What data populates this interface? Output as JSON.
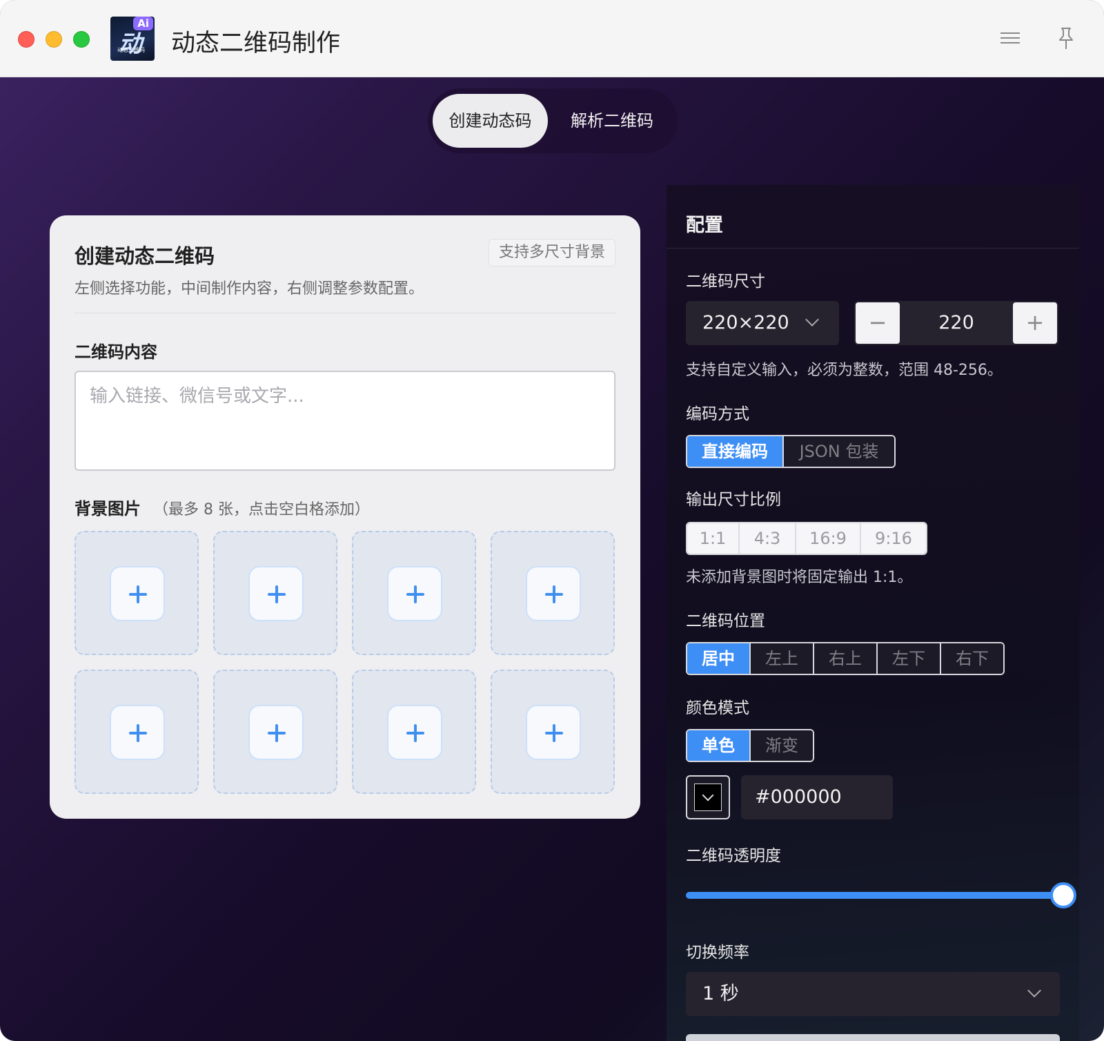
{
  "window": {
    "title": "动态二维码制作",
    "app_icon": {
      "badge": "Ai",
      "glyph": "动",
      "caption": "动态二维码"
    }
  },
  "tabs": [
    {
      "label": "创建动态码",
      "active": true
    },
    {
      "label": "解析二维码",
      "active": false
    }
  ],
  "create_card": {
    "title": "创建动态二维码",
    "badge": "支持多尺寸背景",
    "description": "左侧选择功能，中间制作内容，右侧调整参数配置。",
    "content_label": "二维码内容",
    "content_placeholder": "输入链接、微信号或文字...",
    "content_value": "",
    "bg_label": "背景图片",
    "bg_hint": "（最多 8 张，点击空白格添加）",
    "bg_slot_count": 8
  },
  "config": {
    "title": "配置",
    "size": {
      "label": "二维码尺寸",
      "preset": "220×220",
      "value": "220",
      "minus": "−",
      "plus": "+",
      "note": "支持自定义输入，必须为整数，范围 48-256。"
    },
    "encoding": {
      "label": "编码方式",
      "options": [
        "直接编码",
        "JSON 包装"
      ],
      "selected": "直接编码"
    },
    "aspect": {
      "label": "输出尺寸比例",
      "options": [
        "1:1",
        "4:3",
        "16:9",
        "9:16"
      ],
      "note": "未添加背景图时将固定输出 1:1。"
    },
    "position": {
      "label": "二维码位置",
      "options": [
        "居中",
        "左上",
        "右上",
        "左下",
        "右下"
      ],
      "selected": "居中"
    },
    "color_mode": {
      "label": "颜色模式",
      "options": [
        "单色",
        "渐变"
      ],
      "selected": "单色",
      "color_hex": "#000000"
    },
    "opacity": {
      "label": "二维码透明度",
      "value": 1.0,
      "accent": "#3d8ef5"
    },
    "frequency": {
      "label": "切换频率",
      "value": "1 秒"
    }
  },
  "colors": {
    "accent": "#3d8ef5",
    "traffic_red": "#ff5f57",
    "traffic_yellow": "#febc2e",
    "traffic_green": "#28c840"
  }
}
